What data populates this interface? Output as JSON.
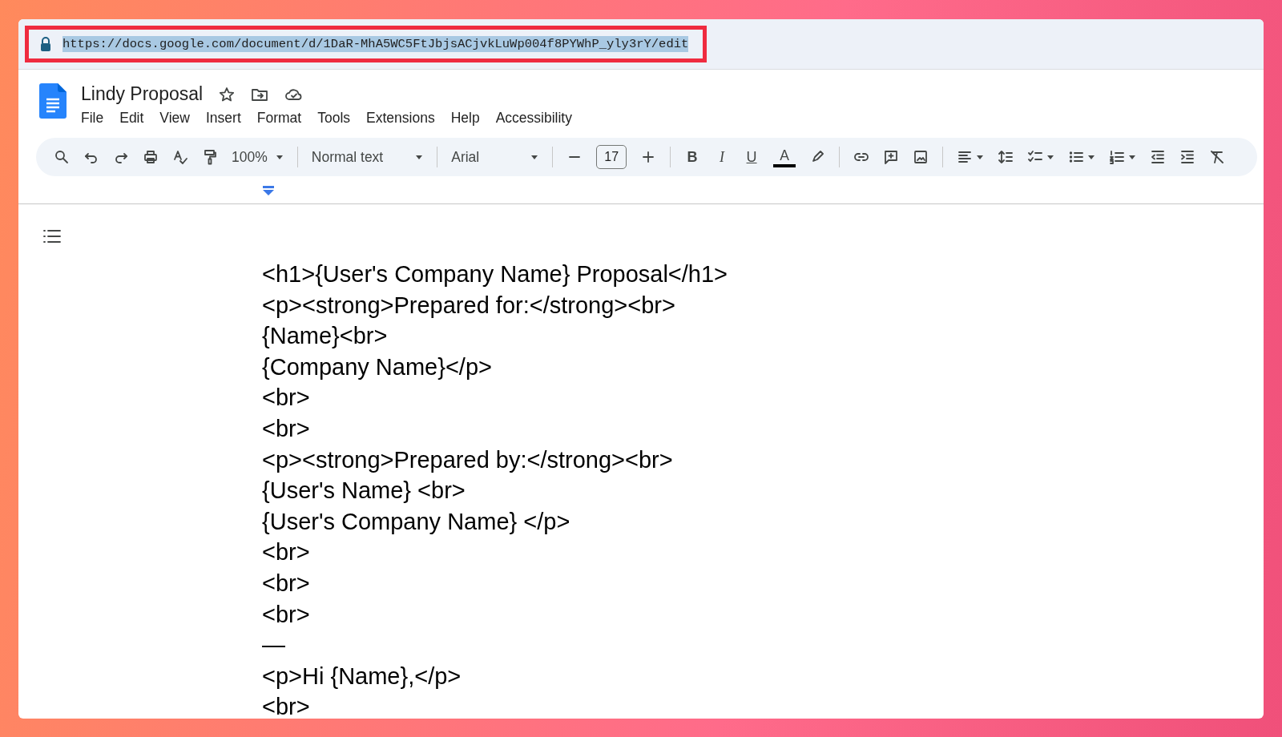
{
  "address_bar": {
    "url": "https://docs.google.com/document/d/1DaR-MhA5WC5FtJbjsACjvkLuWp004f8PYWhP_yly3rY/edit",
    "highlighted": true
  },
  "document": {
    "title": "Lindy Proposal"
  },
  "menu": [
    "File",
    "Edit",
    "View",
    "Insert",
    "Format",
    "Tools",
    "Extensions",
    "Help",
    "Accessibility"
  ],
  "toolbar": {
    "zoom": "100%",
    "style": "Normal text",
    "font": "Arial",
    "font_size": "17",
    "bold": "B",
    "italic": "I",
    "underline": "U",
    "text_color": "A"
  },
  "body_lines": [
    "<h1>{User's Company Name} Proposal</h1>",
    "<p><strong>Prepared for:</strong><br>",
    "{Name}<br>",
    "{Company Name}</p>",
    "<br>",
    "<br>",
    "<p><strong>Prepared by:</strong><br>",
    "{User's Name} <br>",
    "{User's Company Name} </p>",
    "<br>",
    "<br>",
    "<br>",
    "—",
    "<p>Hi {Name},</p>",
    "<br>"
  ]
}
